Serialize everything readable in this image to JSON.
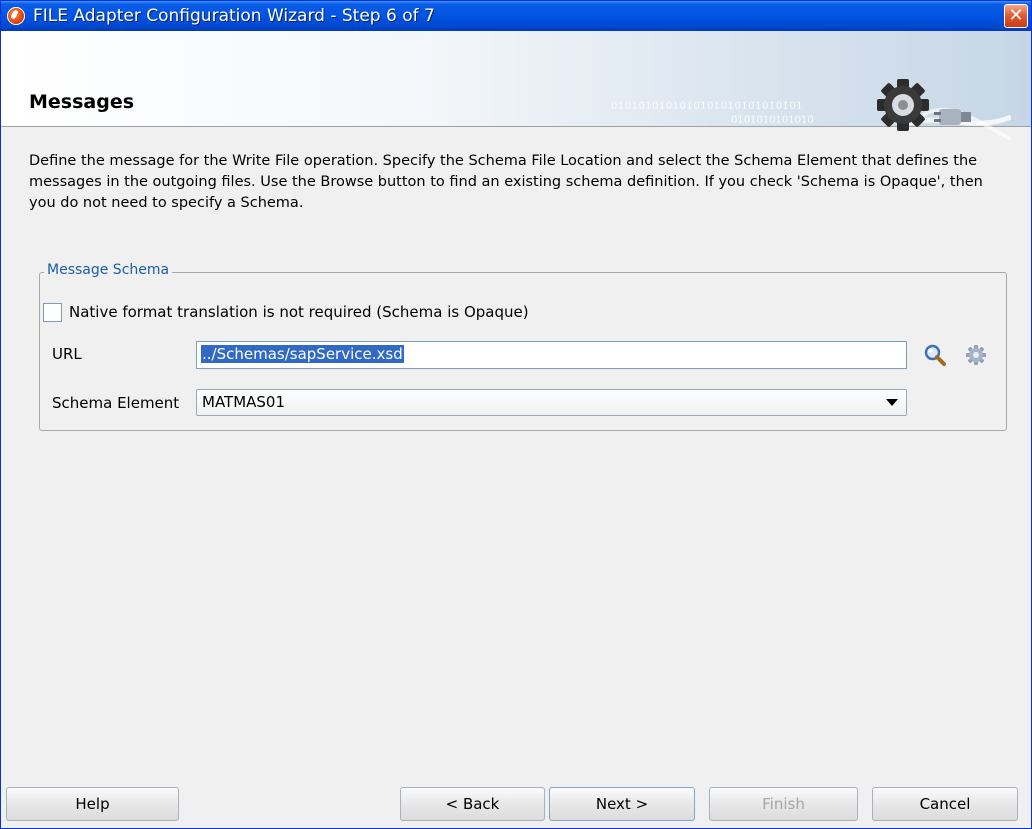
{
  "window": {
    "title": "FILE Adapter Configuration Wizard - Step 6 of 7",
    "close_glyph": "✕"
  },
  "banner": {
    "title": "Messages",
    "decor_binary_1": "0101010101010101010101010101",
    "decor_binary_2": "0101010101010"
  },
  "description": "Define the message for the Write File operation.  Specify the Schema File Location and select the Schema Element that defines the messages in the outgoing files. Use the Browse button to find an existing schema definition. If you check 'Schema is Opaque', then you do not need to specify a Schema.",
  "message_schema": {
    "legend": "Message Schema",
    "opaque_checkbox": {
      "label": "Native format translation is not required (Schema is Opaque)",
      "checked": false
    },
    "url": {
      "label": "URL",
      "value": "../Schemas/sapService.xsd"
    },
    "schema_element": {
      "label": "Schema Element",
      "value": "MATMAS01"
    },
    "icons": [
      "search-icon",
      "gear-icon"
    ]
  },
  "buttons": {
    "help": "Help",
    "back": "< Back",
    "next": "Next >",
    "finish": "Finish",
    "cancel": "Cancel"
  },
  "colors": {
    "titlebar": "#0054e3",
    "legend_text": "#1a5ea8",
    "selection": "#316ac5"
  }
}
